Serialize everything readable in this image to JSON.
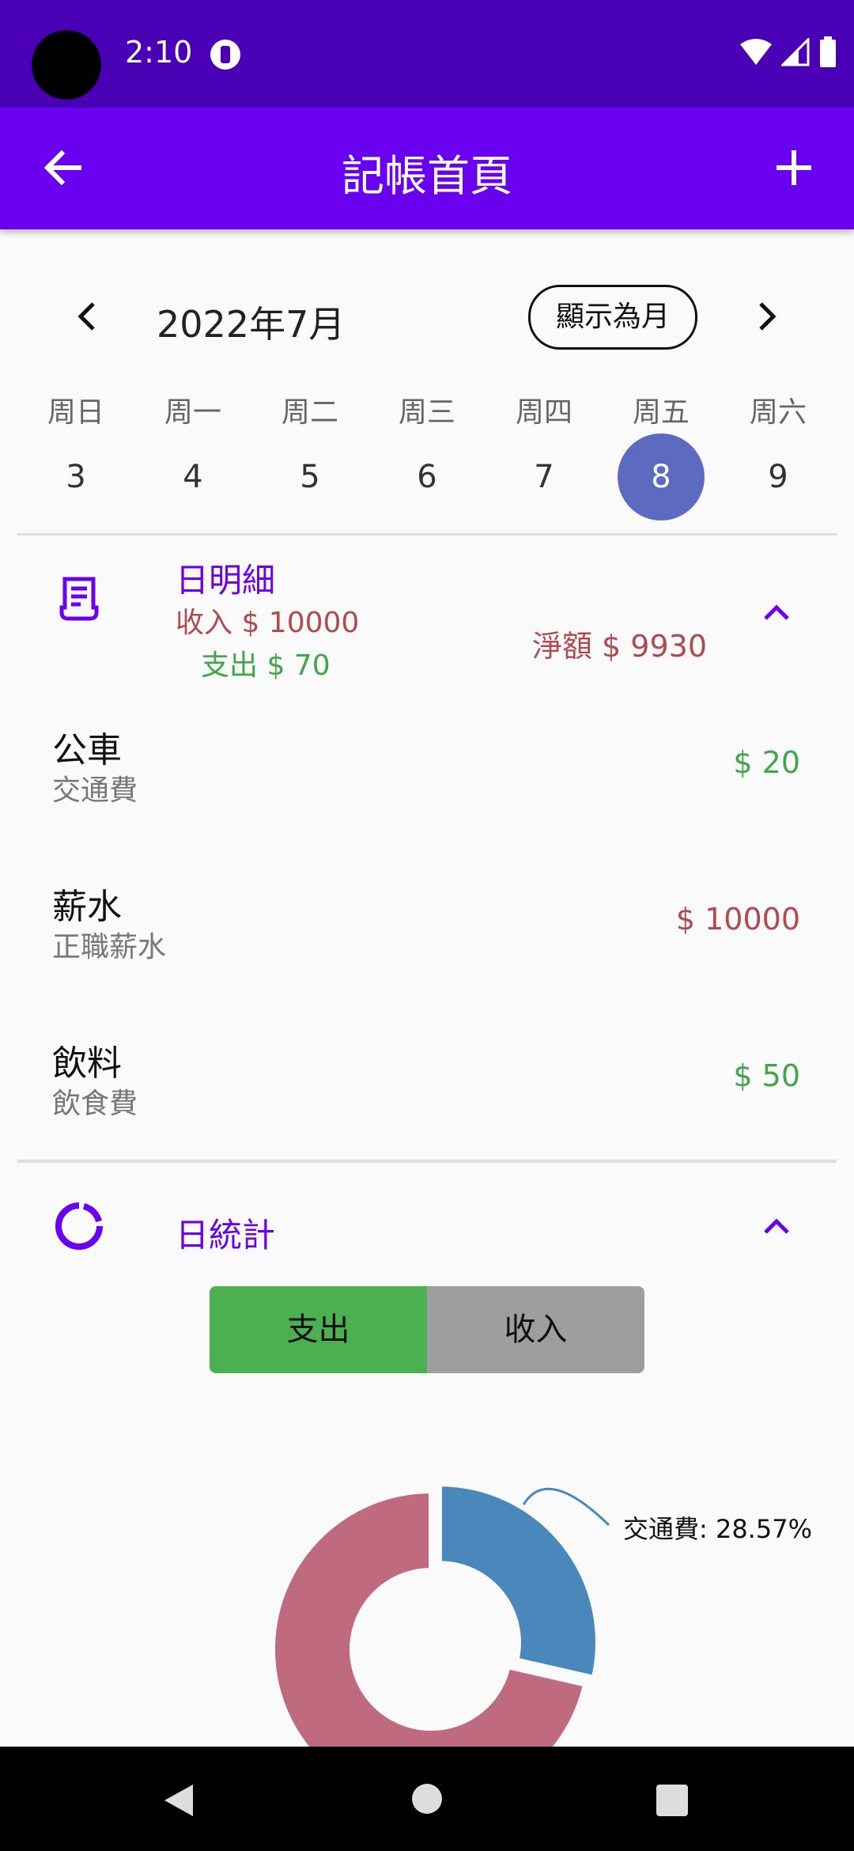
{
  "status_bar": {
    "time": "2:10"
  },
  "app_bar": {
    "title": "記帳首頁"
  },
  "calendar": {
    "month_label": "2022年7月",
    "toggle_label": "顯示為月",
    "weekdays": [
      "周日",
      "周一",
      "周二",
      "周三",
      "周四",
      "周五",
      "周六"
    ],
    "days": [
      "3",
      "4",
      "5",
      "6",
      "7",
      "8",
      "9"
    ],
    "selected_day": "8"
  },
  "day_detail": {
    "title": "日明細",
    "income_summary": "收入 $ 10000",
    "expense_summary": "支出 $ 70",
    "net_summary": "淨額 $ 9930",
    "entries": [
      {
        "name": "公車",
        "category": "交通費",
        "amount": "$ 20",
        "type": "expense"
      },
      {
        "name": "薪水",
        "category": "正職薪水",
        "amount": "$ 10000",
        "type": "income"
      },
      {
        "name": "飲料",
        "category": "飲食費",
        "amount": "$ 50",
        "type": "expense"
      }
    ]
  },
  "day_stats": {
    "title": "日統計",
    "tabs": [
      "支出",
      "收入"
    ],
    "active_tab": "支出",
    "slice_label": "交通費: 28.57%"
  },
  "chart_data": {
    "type": "pie",
    "categories": [
      "交通費",
      "飲食費"
    ],
    "values": [
      28.57,
      71.43
    ],
    "colors": [
      "#4a88bc",
      "#c06a80"
    ],
    "title": ""
  },
  "colors": {
    "status_bar": "#4a00b5",
    "app_bar": "#6a00f0",
    "accent": "#6a00f0",
    "income": "#b04a4f",
    "expense": "#3fa64a",
    "selected_day": "#5c6bc0"
  }
}
